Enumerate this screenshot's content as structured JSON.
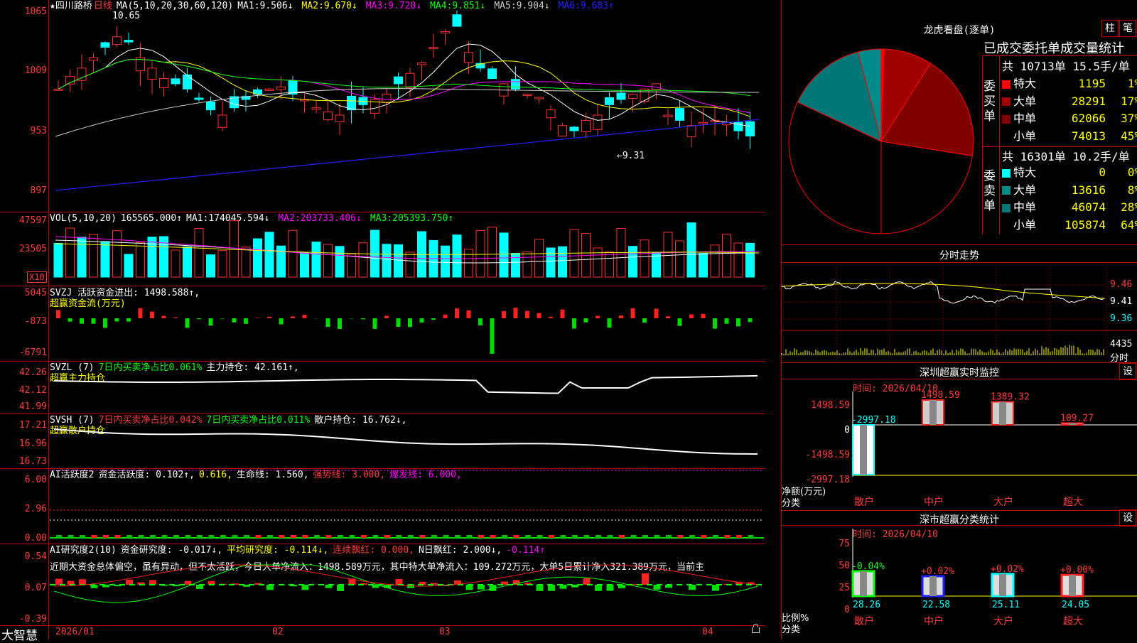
{
  "brand": "大智慧",
  "stock": {
    "name": "★四川路桥",
    "period": "日线"
  },
  "price_panel": {
    "ma_header": "MA(5,10,20,30,60,120)",
    "ma": [
      {
        "label": "MA1:",
        "value": "9.506↓",
        "color": "#ffffff"
      },
      {
        "label": "MA2:",
        "value": "9.670↓",
        "color": "#ffff00"
      },
      {
        "label": "MA3:",
        "value": "9.720↓",
        "color": "#ff00ff"
      },
      {
        "label": "MA4:",
        "value": "9.851↓",
        "color": "#00ff00"
      },
      {
        "label": "MA5:",
        "value": "9.904↓",
        "color": "#cccccc"
      },
      {
        "label": "MA6:",
        "value": "9.683↑",
        "color": "#2222ff"
      }
    ],
    "y_ticks": [
      "1065",
      "1009",
      "953",
      "897"
    ],
    "high_label": "10.65",
    "low_label": "←9.31"
  },
  "vol_panel": {
    "header": "VOL(5,10,20)",
    "value": "165565.000↑",
    "ma": [
      {
        "label": "MA1:",
        "value": "174045.594↓",
        "color": "#ffffff"
      },
      {
        "label": "MA2:",
        "value": "203733.406↓",
        "color": "#ff00ff"
      },
      {
        "label": "MA3:",
        "value": "205393.750↑",
        "color": "#00ff00"
      }
    ],
    "y_ticks": [
      "47597",
      "23505"
    ],
    "unit": "X10"
  },
  "svzj_panel": {
    "line1": "SVZJ  活跃资金进出: 1498.588↑,",
    "line2": "超赢资金流(万元)",
    "y_ticks": [
      "5045",
      "-873",
      "-6791"
    ]
  },
  "svzl_panel": {
    "a": "SVZL (7)",
    "b": "7日内买卖净占比0.061%",
    "c": "主力持仓: 42.161↑,",
    "line2": "超赢主力持仓",
    "y_ticks": [
      "42.26",
      "42.12",
      "41.99"
    ]
  },
  "svsh_panel": {
    "a": "SVSH (7)",
    "b": "7日内买卖净占比0.042%",
    "c": "7日内买卖净占比0.011%",
    "d": "散户持仓: 16.762↓,",
    "line2": "超赢散户持仓",
    "y_ticks": [
      "17.21",
      "16.96",
      "16.73"
    ]
  },
  "ai_active_panel": {
    "a": "AI活跃度2",
    "b": "资金活跃度: 0.102↑,",
    "c": "0.616,",
    "d": "生命线: 1.560,",
    "e": "强势线: 3.000,",
    "f": "爆发线: 6.000,",
    "y_ticks": [
      "6.00",
      "2.96",
      "0.00"
    ]
  },
  "ai_research_panel": {
    "a": "AI研究度2(10)",
    "b": "资金研究度: -0.017↓,",
    "c": "平均研究度: -0.114↓,",
    "d": "连续飘红: 0.000,",
    "e": "N日飘红: 2.000↓,",
    "f": "-0.114↑",
    "commentary": "近期大资金总体偏空，虽有异动，但不太活跃，今日大单净流入：1498.589万元，其中特大单净流入：109.272万元，大单5日累计净入321.389万元，当前主",
    "y_ticks": [
      "0.54",
      "0.07",
      "-0.39"
    ]
  },
  "x_axis": [
    "2026/01",
    "02",
    "03",
    "04"
  ],
  "dragon_tiger": {
    "title": "龙虎看盘(逐单)",
    "btn_bar": "柱",
    "btn_pen": "笔",
    "subtitle": "已成交委托单成交量统计",
    "buy": {
      "side_label": "委买单",
      "summary": "共 10713单 15.5手/单",
      "rows": [
        {
          "name": "特大",
          "vol": "1195",
          "pct": "1%",
          "color": "#ff0000"
        },
        {
          "name": "大单",
          "vol": "28291",
          "pct": "17%",
          "color": "#a00000"
        },
        {
          "name": "中单",
          "vol": "62066",
          "pct": "37%",
          "color": "#800000"
        },
        {
          "name": "小单",
          "vol": "74013",
          "pct": "45%",
          "color": "#000000"
        }
      ]
    },
    "sell": {
      "side_label": "委卖单",
      "summary": "共 16301单 10.2手/单",
      "rows": [
        {
          "name": "特大",
          "vol": "0",
          "pct": "0%",
          "color": "#00ffff"
        },
        {
          "name": "大单",
          "vol": "13616",
          "pct": "8%",
          "color": "#008b8b"
        },
        {
          "name": "中单",
          "vol": "46074",
          "pct": "28%",
          "color": "#007777"
        },
        {
          "name": "小单",
          "vol": "105874",
          "pct": "64%",
          "color": "#000000"
        }
      ]
    }
  },
  "intraday": {
    "title": "分时走势",
    "y_ticks": [
      "9.46",
      "9.41",
      "9.36"
    ],
    "vol_tick": "4435",
    "vol_unit": "分时"
  },
  "realtime": {
    "title": "深圳超赢实时监控",
    "btn": "设",
    "time": "时间: 2026/04/10",
    "y_ticks": [
      "1498.59",
      "0",
      "-1498.59",
      "-2997.18"
    ],
    "unit1": "净额(万元)",
    "unit2": "分类",
    "bars": [
      {
        "cat": "散户",
        "value": "-2997.18"
      },
      {
        "cat": "中户",
        "value": "1498.59"
      },
      {
        "cat": "大户",
        "value": "1389.32"
      },
      {
        "cat": "超大",
        "value": "109.27"
      }
    ]
  },
  "category_stats": {
    "title": "深市超赢分类统计",
    "btn": "设",
    "time": "时间: 2026/04/10",
    "y_ticks": [
      "75",
      "50",
      "25",
      "0"
    ],
    "unit1": "比例%",
    "unit2": "分类",
    "bars": [
      {
        "cat": "散户",
        "pct": "28.26",
        "delta": "-0.04%",
        "delta_color": "#00ff00"
      },
      {
        "cat": "中户",
        "pct": "22.58",
        "delta": "+0.02%",
        "delta_color": "#ff3b3b"
      },
      {
        "cat": "大户",
        "pct": "25.11",
        "delta": "+0.02%",
        "delta_color": "#ff3b3b"
      },
      {
        "cat": "超大",
        "pct": "24.05",
        "delta": "+0.00%",
        "delta_color": "#ff3b3b"
      }
    ]
  }
}
